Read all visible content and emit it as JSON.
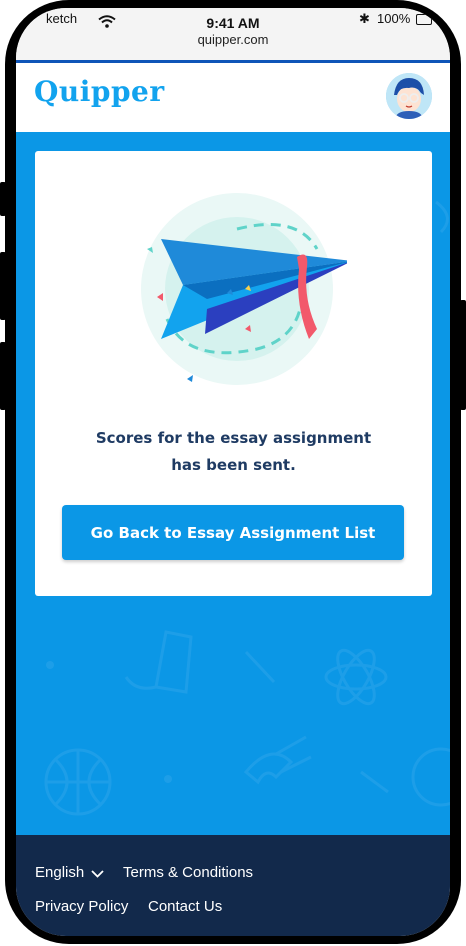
{
  "status_bar": {
    "carrier": "ketch",
    "time": "9:41 AM",
    "url": "quipper.com",
    "battery": "100%"
  },
  "header": {
    "logo": "Quipper"
  },
  "card": {
    "message_line1": "Scores for the essay assignment",
    "message_line2": "has been sent.",
    "button_label": "Go Back to Essay Assignment List"
  },
  "footer": {
    "language": "English",
    "terms": "Terms & Conditions",
    "privacy": "Privacy Policy",
    "contact": "Contact Us"
  },
  "colors": {
    "brand_blue": "#0b97e6",
    "logo_blue": "#12a3ee",
    "footer_navy": "#12294b",
    "message_text": "#1f3b63"
  }
}
